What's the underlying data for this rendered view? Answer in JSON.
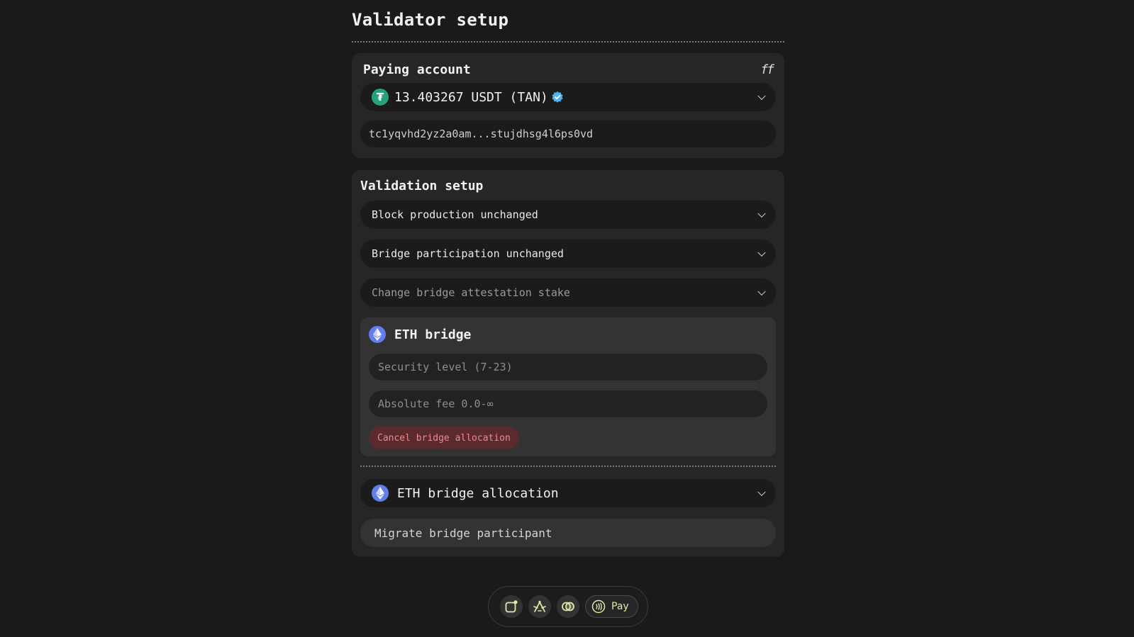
{
  "page": {
    "title": "Validator setup"
  },
  "paying_account": {
    "title": "Paying account",
    "ff_icon_text": "ff",
    "token_icon": "tether-icon",
    "balance": "13.403267 USDT (TAN)",
    "verified_icon": "verified-badge-icon",
    "address": "tc1yqvhd2yz2a0am...stujdhsg4l6ps0vd"
  },
  "validation": {
    "title": "Validation setup",
    "block_production": "Block production unchanged",
    "bridge_participation": "Bridge participation unchanged",
    "change_stake_placeholder": "Change bridge attestation stake",
    "eth_bridge": {
      "title": "ETH bridge",
      "security_placeholder": "Security level (7-23)",
      "fee_placeholder": "Absolute fee 0.0-∞",
      "cancel_label": "Cancel bridge allocation"
    },
    "allocation_label": "ETH bridge allocation",
    "migrate_label": "Migrate bridge participant"
  },
  "dock": {
    "pay_label": "Pay",
    "icons": [
      "wallet-icon",
      "network-icon",
      "toggle-icon",
      "contactless-icon"
    ]
  },
  "colors": {
    "background": "#1a1a1a",
    "card": "#262626",
    "tether": "#26a17b",
    "eth": "#627eea",
    "verified": "#4fb3f0",
    "danger_bg": "#5a2a2e",
    "danger_text": "#ef8a8a",
    "dock_accent": "#dfe9a8"
  }
}
